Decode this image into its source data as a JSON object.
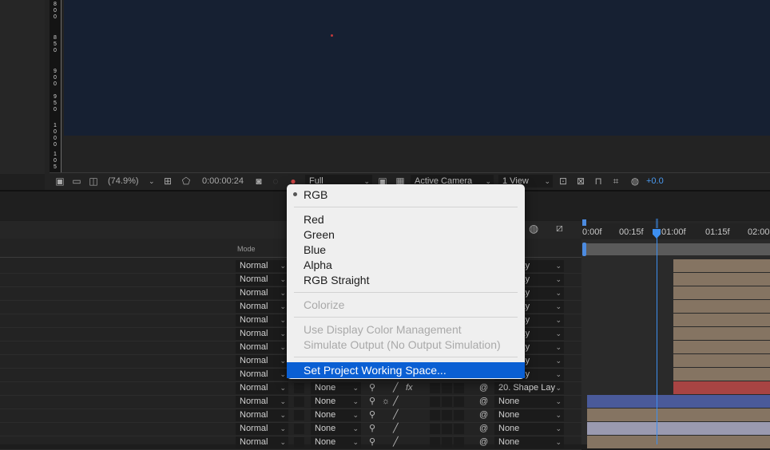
{
  "viewer": {
    "ruler_labels": [
      "8",
      "0",
      "0",
      "8",
      "5",
      "0",
      "9",
      "0",
      "0",
      "9",
      "5",
      "0",
      "1",
      "0",
      "0",
      "0",
      "1",
      "0",
      "5"
    ],
    "toolbar": {
      "zoom": "(74.9%)",
      "timecode": "0:00:00:24",
      "resolution": "Full",
      "camera": "Active Camera",
      "view_layout": "1 View",
      "exposure": "+0.0"
    }
  },
  "colors": {
    "accent": "#3d8ff0",
    "menu_highlight": "#0a5fd3",
    "canvas": "#162032",
    "red_bar": "#a84443",
    "blue_bar": "#4a5a9a",
    "tan_bar": "#857462"
  },
  "layer_panel": {
    "mode_header": "Mode",
    "rows": [
      {
        "mode": "Normal",
        "parent": "ape Lay"
      },
      {
        "mode": "Normal",
        "parent": "ape Lay"
      },
      {
        "mode": "Normal",
        "parent": "ape Lay"
      },
      {
        "mode": "Normal",
        "parent": "ape Lay"
      },
      {
        "mode": "Normal",
        "parent": "ape Lay"
      },
      {
        "mode": "Normal",
        "parent": "ape Lay"
      },
      {
        "mode": "Normal",
        "parent": "ape Lay"
      },
      {
        "mode": "Normal",
        "parent": "ape Lay"
      },
      {
        "mode": "Normal",
        "parent": "ape Lay"
      },
      {
        "mode": "Normal",
        "trkmat": "None",
        "parent": "20. Shape Lay"
      },
      {
        "mode": "Normal",
        "trkmat": "None",
        "parent": "None"
      },
      {
        "mode": "Normal",
        "trkmat": "None",
        "parent": "None"
      },
      {
        "mode": "Normal",
        "trkmat": "None",
        "parent": "None"
      },
      {
        "mode": "Normal",
        "trkmat": "None",
        "parent": "None"
      }
    ],
    "fx_label": "fx"
  },
  "timeline": {
    "ticks": [
      "0:00f",
      "00:15f",
      "01:00f",
      "01:15f",
      "02:00"
    ]
  },
  "channel_menu": {
    "items": [
      {
        "label": "RGB",
        "checked": true
      },
      {
        "label": "Red"
      },
      {
        "label": "Green"
      },
      {
        "label": "Blue"
      },
      {
        "label": "Alpha"
      },
      {
        "label": "RGB Straight"
      },
      {
        "label": "Colorize",
        "disabled": true
      },
      {
        "label": "Use Display Color Management",
        "disabled": true
      },
      {
        "label": "Simulate Output (No Output Simulation)",
        "disabled": true
      },
      {
        "label": "Set Project Working Space...",
        "highlighted": true
      }
    ]
  }
}
